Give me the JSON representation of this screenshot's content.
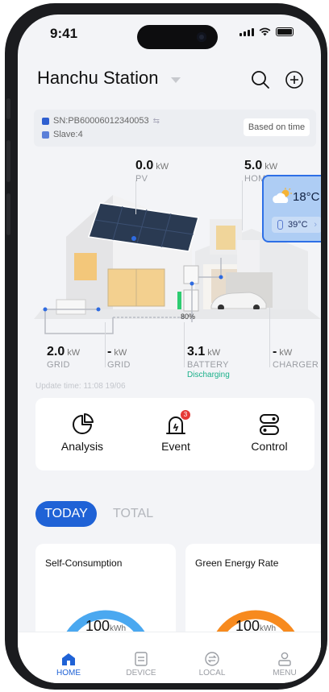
{
  "status_bar": {
    "time": "9:41"
  },
  "header": {
    "title": "Hanchu Station"
  },
  "device": {
    "sn": "SN:PB60006012340053",
    "slave": "Slave:4",
    "based_on": "Based on time"
  },
  "flow": {
    "pv": {
      "value": "0.0",
      "unit": "kW",
      "label": "PV"
    },
    "home": {
      "value": "5.0",
      "unit": "kW",
      "label": "HOME"
    },
    "grid_1": {
      "value": "2.0",
      "unit": "kW",
      "label": "GRID"
    },
    "grid_2": {
      "value": "-",
      "unit": "kW",
      "label": "GRID"
    },
    "battery": {
      "value": "3.1",
      "unit": "kW",
      "label": "BATTERY",
      "status": "Discharging",
      "soc": "80%"
    },
    "charger": {
      "value": "-",
      "unit": "kW",
      "label": "CHARGER"
    }
  },
  "weather": {
    "temp": "18°C",
    "sub_temp": "39°C"
  },
  "update_time": "Update time: 11:08 19/06",
  "actions": {
    "analysis": "Analysis",
    "event": "Event",
    "event_badge": "3",
    "control": "Control"
  },
  "tabs": {
    "today": "TODAY",
    "total": "TOTAL"
  },
  "cards": {
    "self_consumption": {
      "title": "Self-Consumption",
      "value": "100",
      "unit": "kWh"
    },
    "green_rate": {
      "title": "Green Energy Rate",
      "value": "100",
      "unit": "kWh"
    }
  },
  "nav": {
    "home": "HOME",
    "device": "DEVICE",
    "local": "LOCAL",
    "menu": "MENU"
  },
  "colors": {
    "accent": "#1f62d6",
    "discharging": "#1bb08a",
    "gauge_blue": "#4aa8f0",
    "gauge_orange": "#f78a1e",
    "badge": "#e53935"
  }
}
